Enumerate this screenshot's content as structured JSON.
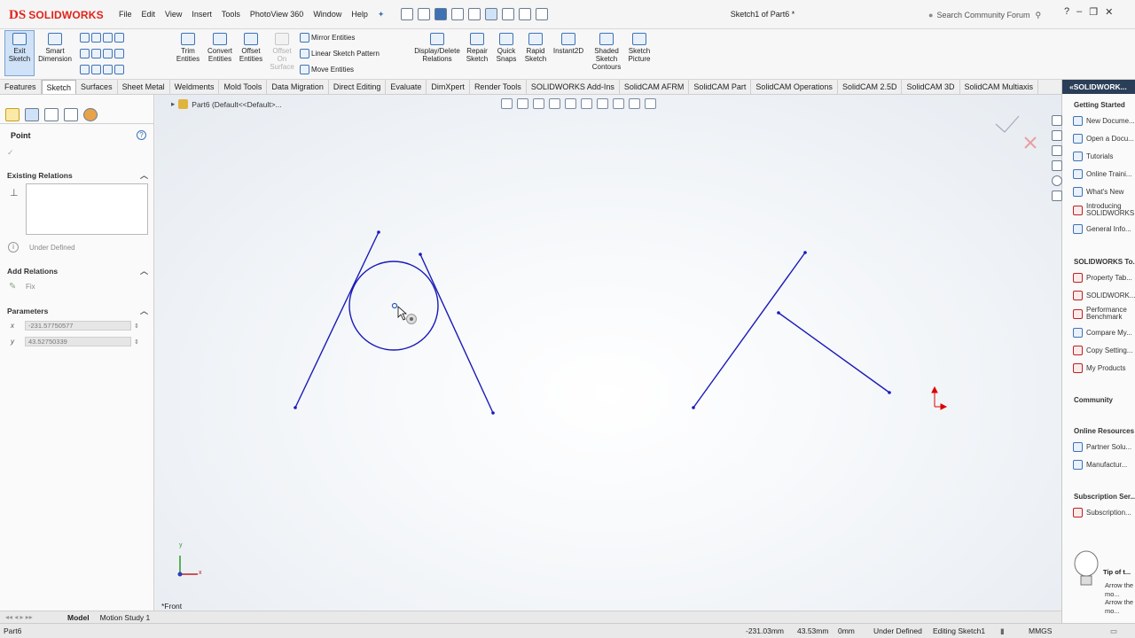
{
  "app": {
    "logo_prefix": "DS",
    "logo_name": "SOLIDWORKS",
    "doc_title": "Sketch1 of Part6 *"
  },
  "menu": [
    "File",
    "Edit",
    "View",
    "Insert",
    "Tools",
    "PhotoView 360",
    "Window",
    "Help"
  ],
  "search": {
    "placeholder": "Search Community Forum"
  },
  "window_controls": [
    "?",
    "–",
    "❐",
    "✕"
  ],
  "ribbon": {
    "exit_sketch": "Exit Sketch",
    "smart_dimension": "Smart Dimension",
    "trim_entities": "Trim Entities",
    "convert_entities": "Convert Entities",
    "offset_entities": "Offset Entities",
    "offset_on_surface": "Offset On Surface",
    "mirror_entities": "Mirror Entities",
    "linear_sketch_pattern": "Linear Sketch Pattern",
    "move_entities": "Move Entities",
    "display_delete_relations": "Display/Delete Relations",
    "repair_sketch": "Repair Sketch",
    "quick_snaps": "Quick Snaps",
    "rapid_sketch": "Rapid Sketch",
    "instant2d": "Instant2D",
    "shaded_sketch_contours": "Shaded Sketch Contours",
    "sketch_picture": "Sketch Picture"
  },
  "tabs": [
    "Features",
    "Sketch",
    "Surfaces",
    "Sheet Metal",
    "Weldments",
    "Mold Tools",
    "Data Migration",
    "Direct Editing",
    "Evaluate",
    "DimXpert",
    "Render Tools",
    "SOLIDWORKS Add-Ins",
    "SolidCAM AFRM",
    "SolidCAM Part",
    "SolidCAM Operations",
    "SolidCAM 2.5D",
    "SolidCAM 3D",
    "SolidCAM Multiaxis"
  ],
  "active_tab": "Sketch",
  "property_manager": {
    "title": "Point",
    "existing_relations": "Existing Relations",
    "status": "Under Defined",
    "add_relations": "Add Relations",
    "fix": "Fix",
    "parameters": "Parameters",
    "x_label": "x",
    "y_label": "y",
    "x_value": "-231.57750577",
    "y_value": "43.52750339"
  },
  "graphics": {
    "breadcrumb": "Part6  (Default<<Default>...",
    "view_label": "*Front",
    "axis_x": "x",
    "axis_y": "y"
  },
  "bottom_tabs": [
    "Model",
    "Motion Study 1"
  ],
  "status_bar": {
    "part": "Part6",
    "x": "-231.03mm",
    "y": "43.53mm",
    "z": "0mm",
    "state": "Under Defined",
    "editing": "Editing Sketch1",
    "units": "MMGS"
  },
  "task_pane": {
    "header": "«SOLIDWORK...",
    "getting_started": "Getting Started",
    "gs_items": [
      "New Docume...",
      "Open a Docu...",
      "Tutorials",
      "Online Traini...",
      "What's New",
      "Introducing SOLIDWORKS",
      "General Info..."
    ],
    "tools_title": "SOLIDWORKS To...",
    "tools_items": [
      "Property Tab...",
      "SOLIDWORK...",
      "Performance Benchmark",
      "Compare My...",
      "Copy Setting...",
      "My Products"
    ],
    "community": "Community",
    "online_resources": "Online Resources",
    "online_items": [
      "Partner Solu...",
      "Manufactur..."
    ],
    "subscription": "Subscription Ser...",
    "subscription_items": [
      "Subscription..."
    ],
    "tip_title": "Tip of t...",
    "tip_text": "Arrow the mo... Arrow the mo..."
  }
}
